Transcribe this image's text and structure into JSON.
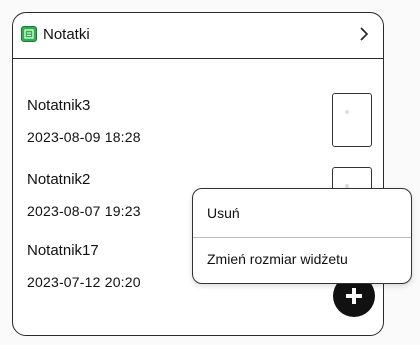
{
  "header": {
    "title": "Notatki",
    "icon": "notes-app-icon",
    "chevron": "chevron-right-icon"
  },
  "notes": [
    {
      "name": "Notatnik3",
      "date": "2023-08-09 18:28"
    },
    {
      "name": "Notatnik2",
      "date": "2023-08-07 19:23"
    },
    {
      "name": "Notatnik17",
      "date": "2023-07-12 20:20"
    }
  ],
  "fab": {
    "icon": "plus-icon"
  },
  "context_menu": {
    "items": [
      {
        "label": "Usuń"
      },
      {
        "label": "Zmień rozmiar widżetu"
      }
    ]
  },
  "colors": {
    "app_icon": "#2bb24c",
    "fab": "#111111"
  }
}
